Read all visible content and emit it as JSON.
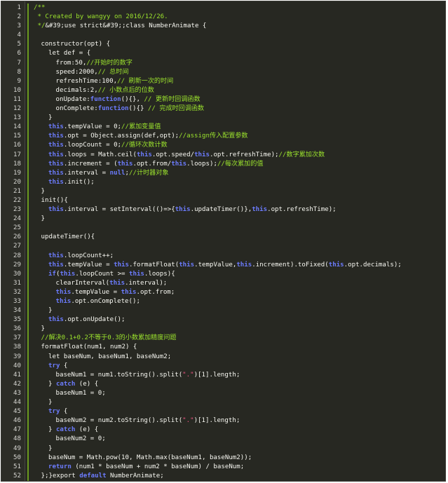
{
  "editor": {
    "colors": {
      "background": "#272822",
      "comment": "#9be22d",
      "keyword": "#6c7cff",
      "literal": "#ae81ff",
      "string": "#f25584",
      "plain": "#f8f8f2"
    },
    "lines": [
      {
        "n": "1",
        "indent": 0,
        "tokens": [
          {
            "t": "/**",
            "c": "comment"
          }
        ]
      },
      {
        "n": "2",
        "indent": 0,
        "tokens": [
          {
            "t": " * Created by wangyy on 2016/12/26.",
            "c": "comment"
          }
        ]
      },
      {
        "n": "3",
        "indent": 0,
        "tokens": [
          {
            "t": " */",
            "c": "comment"
          },
          {
            "t": "&#39;use strict&#39;",
            "c": "plain"
          },
          {
            "t": ";class NumberAnimate {",
            "c": "plain"
          }
        ]
      },
      {
        "n": "4",
        "indent": 0,
        "tokens": []
      },
      {
        "n": "5",
        "indent": 1,
        "tokens": [
          {
            "t": "constructor(opt) {",
            "c": "plain"
          }
        ]
      },
      {
        "n": "6",
        "indent": 2,
        "tokens": [
          {
            "t": "let def = {",
            "c": "plain"
          }
        ]
      },
      {
        "n": "7",
        "indent": 3,
        "tokens": [
          {
            "t": "from:50,",
            "c": "plain"
          },
          {
            "t": "//开始时的数字",
            "c": "comment"
          }
        ]
      },
      {
        "n": "8",
        "indent": 3,
        "tokens": [
          {
            "t": "speed:2000,",
            "c": "plain"
          },
          {
            "t": "// 总时间",
            "c": "comment"
          }
        ]
      },
      {
        "n": "9",
        "indent": 3,
        "tokens": [
          {
            "t": "refreshTime:100,",
            "c": "plain"
          },
          {
            "t": "// 刷新一次的时间",
            "c": "comment"
          }
        ]
      },
      {
        "n": "10",
        "indent": 3,
        "tokens": [
          {
            "t": "decimals:2,",
            "c": "plain"
          },
          {
            "t": "// 小数点后的位数",
            "c": "comment"
          }
        ]
      },
      {
        "n": "11",
        "indent": 3,
        "tokens": [
          {
            "t": "onUpdate:",
            "c": "plain"
          },
          {
            "t": "function",
            "c": "keyword"
          },
          {
            "t": "(){}, ",
            "c": "plain"
          },
          {
            "t": "// 更新时回调函数",
            "c": "comment"
          }
        ]
      },
      {
        "n": "12",
        "indent": 3,
        "tokens": [
          {
            "t": "onComplete:",
            "c": "plain"
          },
          {
            "t": "function",
            "c": "keyword"
          },
          {
            "t": "(){} ",
            "c": "plain"
          },
          {
            "t": "// 完成时回调函数",
            "c": "comment"
          }
        ]
      },
      {
        "n": "13",
        "indent": 2,
        "tokens": [
          {
            "t": "}",
            "c": "plain"
          }
        ]
      },
      {
        "n": "14",
        "indent": 2,
        "tokens": [
          {
            "t": "this",
            "c": "keyword"
          },
          {
            "t": ".tempValue = 0;",
            "c": "plain"
          },
          {
            "t": "//累加变量值",
            "c": "comment"
          }
        ]
      },
      {
        "n": "15",
        "indent": 2,
        "tokens": [
          {
            "t": "this",
            "c": "keyword"
          },
          {
            "t": ".opt = Object.assign(def,opt);",
            "c": "plain"
          },
          {
            "t": "//assign传入配置参数",
            "c": "comment"
          }
        ]
      },
      {
        "n": "16",
        "indent": 2,
        "tokens": [
          {
            "t": "this",
            "c": "keyword"
          },
          {
            "t": ".loopCount = 0;",
            "c": "plain"
          },
          {
            "t": "//循环次数计数",
            "c": "comment"
          }
        ]
      },
      {
        "n": "17",
        "indent": 2,
        "tokens": [
          {
            "t": "this",
            "c": "keyword"
          },
          {
            "t": ".loops = Math.ceil(",
            "c": "plain"
          },
          {
            "t": "this",
            "c": "keyword"
          },
          {
            "t": ".opt.speed/",
            "c": "plain"
          },
          {
            "t": "this",
            "c": "keyword"
          },
          {
            "t": ".opt.refreshTime);",
            "c": "plain"
          },
          {
            "t": "//数字累加次数",
            "c": "comment"
          }
        ]
      },
      {
        "n": "18",
        "indent": 2,
        "tokens": [
          {
            "t": "this",
            "c": "keyword"
          },
          {
            "t": ".increment = (",
            "c": "plain"
          },
          {
            "t": "this",
            "c": "keyword"
          },
          {
            "t": ".opt.from/",
            "c": "plain"
          },
          {
            "t": "this",
            "c": "keyword"
          },
          {
            "t": ".loops);",
            "c": "plain"
          },
          {
            "t": "//每次累加的值",
            "c": "comment"
          }
        ]
      },
      {
        "n": "19",
        "indent": 2,
        "tokens": [
          {
            "t": "this",
            "c": "keyword"
          },
          {
            "t": ".interval = ",
            "c": "plain"
          },
          {
            "t": "null",
            "c": "keyword"
          },
          {
            "t": ";",
            "c": "plain"
          },
          {
            "t": "//计时器对象",
            "c": "comment"
          }
        ]
      },
      {
        "n": "20",
        "indent": 2,
        "tokens": [
          {
            "t": "this",
            "c": "keyword"
          },
          {
            "t": ".init();",
            "c": "plain"
          }
        ]
      },
      {
        "n": "21",
        "indent": 1,
        "tokens": [
          {
            "t": "}",
            "c": "plain"
          }
        ]
      },
      {
        "n": "22",
        "indent": 1,
        "tokens": [
          {
            "t": "init(){",
            "c": "plain"
          }
        ]
      },
      {
        "n": "23",
        "indent": 2,
        "tokens": [
          {
            "t": "this",
            "c": "keyword"
          },
          {
            "t": ".interval = setInterval(()=>{",
            "c": "plain"
          },
          {
            "t": "this",
            "c": "keyword"
          },
          {
            "t": ".updateTimer()},",
            "c": "plain"
          },
          {
            "t": "this",
            "c": "keyword"
          },
          {
            "t": ".opt.refreshTime);",
            "c": "plain"
          }
        ]
      },
      {
        "n": "24",
        "indent": 1,
        "tokens": [
          {
            "t": "}",
            "c": "plain"
          }
        ]
      },
      {
        "n": "25",
        "indent": 0,
        "tokens": []
      },
      {
        "n": "26",
        "indent": 1,
        "tokens": [
          {
            "t": "updateTimer(){",
            "c": "plain"
          }
        ]
      },
      {
        "n": "27",
        "indent": 0,
        "tokens": []
      },
      {
        "n": "28",
        "indent": 2,
        "tokens": [
          {
            "t": "this",
            "c": "keyword"
          },
          {
            "t": ".loopCount++;",
            "c": "plain"
          }
        ]
      },
      {
        "n": "29",
        "indent": 2,
        "tokens": [
          {
            "t": "this",
            "c": "keyword"
          },
          {
            "t": ".tempValue = ",
            "c": "plain"
          },
          {
            "t": "this",
            "c": "keyword"
          },
          {
            "t": ".formatFloat(",
            "c": "plain"
          },
          {
            "t": "this",
            "c": "keyword"
          },
          {
            "t": ".tempValue,",
            "c": "plain"
          },
          {
            "t": "this",
            "c": "keyword"
          },
          {
            "t": ".increment).toFixed(",
            "c": "plain"
          },
          {
            "t": "this",
            "c": "keyword"
          },
          {
            "t": ".opt.decimals);",
            "c": "plain"
          }
        ]
      },
      {
        "n": "30",
        "indent": 2,
        "tokens": [
          {
            "t": "if",
            "c": "keyword"
          },
          {
            "t": "(",
            "c": "plain"
          },
          {
            "t": "this",
            "c": "keyword"
          },
          {
            "t": ".loopCount >= ",
            "c": "plain"
          },
          {
            "t": "this",
            "c": "keyword"
          },
          {
            "t": ".loops){",
            "c": "plain"
          }
        ]
      },
      {
        "n": "31",
        "indent": 3,
        "tokens": [
          {
            "t": "clearInterval(",
            "c": "plain"
          },
          {
            "t": "this",
            "c": "keyword"
          },
          {
            "t": ".interval);",
            "c": "plain"
          }
        ]
      },
      {
        "n": "32",
        "indent": 3,
        "tokens": [
          {
            "t": "this",
            "c": "keyword"
          },
          {
            "t": ".tempValue = ",
            "c": "plain"
          },
          {
            "t": "this",
            "c": "keyword"
          },
          {
            "t": ".opt.from;",
            "c": "plain"
          }
        ]
      },
      {
        "n": "33",
        "indent": 3,
        "tokens": [
          {
            "t": "this",
            "c": "keyword"
          },
          {
            "t": ".opt.onComplete();",
            "c": "plain"
          }
        ]
      },
      {
        "n": "34",
        "indent": 2,
        "tokens": [
          {
            "t": "}",
            "c": "plain"
          }
        ]
      },
      {
        "n": "35",
        "indent": 2,
        "tokens": [
          {
            "t": "this",
            "c": "keyword"
          },
          {
            "t": ".opt.onUpdate();",
            "c": "plain"
          }
        ]
      },
      {
        "n": "36",
        "indent": 1,
        "tokens": [
          {
            "t": "}",
            "c": "plain"
          }
        ]
      },
      {
        "n": "37",
        "indent": 1,
        "tokens": [
          {
            "t": "//解决0.1+0.2不等于0.3的小数累加精度问题",
            "c": "comment"
          }
        ]
      },
      {
        "n": "38",
        "indent": 1,
        "tokens": [
          {
            "t": "formatFloat(num1, num2) {",
            "c": "plain"
          }
        ]
      },
      {
        "n": "39",
        "indent": 2,
        "tokens": [
          {
            "t": "let baseNum, baseNum1, baseNum2;",
            "c": "plain"
          }
        ]
      },
      {
        "n": "40",
        "indent": 2,
        "tokens": [
          {
            "t": "try",
            "c": "keyword"
          },
          {
            "t": " {",
            "c": "plain"
          }
        ]
      },
      {
        "n": "41",
        "indent": 3,
        "tokens": [
          {
            "t": "baseNum1 = num1.toString().split(",
            "c": "plain"
          },
          {
            "t": "\".\"",
            "c": "string"
          },
          {
            "t": ")[1].length;",
            "c": "plain"
          }
        ]
      },
      {
        "n": "42",
        "indent": 2,
        "tokens": [
          {
            "t": "} ",
            "c": "plain"
          },
          {
            "t": "catch",
            "c": "keyword"
          },
          {
            "t": " (e) {",
            "c": "plain"
          }
        ]
      },
      {
        "n": "43",
        "indent": 3,
        "tokens": [
          {
            "t": "baseNum1 = 0;",
            "c": "plain"
          }
        ]
      },
      {
        "n": "44",
        "indent": 2,
        "tokens": [
          {
            "t": "}",
            "c": "plain"
          }
        ]
      },
      {
        "n": "45",
        "indent": 2,
        "tokens": [
          {
            "t": "try",
            "c": "keyword"
          },
          {
            "t": " {",
            "c": "plain"
          }
        ]
      },
      {
        "n": "46",
        "indent": 3,
        "tokens": [
          {
            "t": "baseNum2 = num2.toString().split(",
            "c": "plain"
          },
          {
            "t": "\".\"",
            "c": "string"
          },
          {
            "t": ")[1].length;",
            "c": "plain"
          }
        ]
      },
      {
        "n": "47",
        "indent": 2,
        "tokens": [
          {
            "t": "} ",
            "c": "plain"
          },
          {
            "t": "catch",
            "c": "keyword"
          },
          {
            "t": " (e) {",
            "c": "plain"
          }
        ]
      },
      {
        "n": "48",
        "indent": 3,
        "tokens": [
          {
            "t": "baseNum2 = 0;",
            "c": "plain"
          }
        ]
      },
      {
        "n": "49",
        "indent": 2,
        "tokens": [
          {
            "t": "}",
            "c": "plain"
          }
        ]
      },
      {
        "n": "50",
        "indent": 2,
        "tokens": [
          {
            "t": "baseNum = Math.pow(10, Math.max(baseNum1, baseNum2));",
            "c": "plain"
          }
        ]
      },
      {
        "n": "51",
        "indent": 2,
        "tokens": [
          {
            "t": "return",
            "c": "keyword"
          },
          {
            "t": " (num1 * baseNum + num2 * baseNum) / baseNum;",
            "c": "plain"
          }
        ]
      },
      {
        "n": "52",
        "indent": 1,
        "tokens": [
          {
            "t": "};}export ",
            "c": "plain"
          },
          {
            "t": "default",
            "c": "keyword"
          },
          {
            "t": " NumberAnimate;",
            "c": "plain"
          }
        ]
      }
    ]
  }
}
